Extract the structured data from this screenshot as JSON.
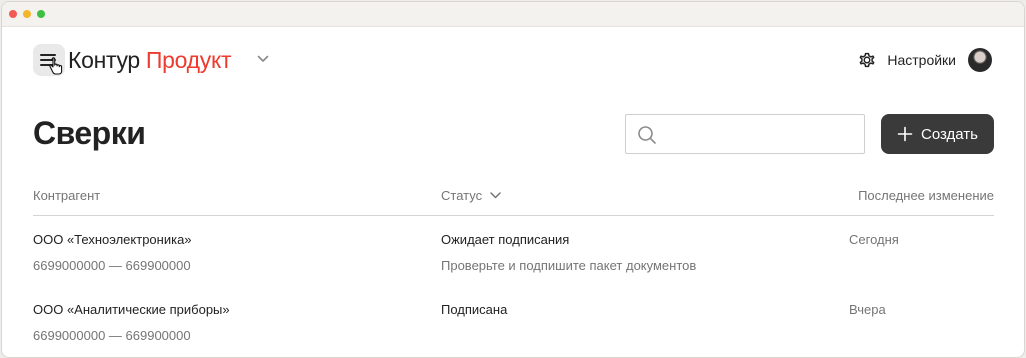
{
  "header": {
    "brand": "Контур",
    "product": "Продукт",
    "settings_label": "Настройки"
  },
  "page": {
    "title": "Сверки"
  },
  "toolbar": {
    "search_placeholder": "",
    "create_label": "Создать"
  },
  "table": {
    "columns": [
      "Контрагент",
      "Статус",
      "Последнее изменение"
    ],
    "rows": [
      {
        "name": "ООО «Техноэлектроника»",
        "inn": "6699000000 — 669900000",
        "status": "Ожидает подписания",
        "hint": "Проверьте и подпишите пакет документов",
        "date": "Сегодня"
      },
      {
        "name": "ООО «Аналитические приборы»",
        "inn": "6699000000 — 669900000",
        "status": "Подписана",
        "hint": "",
        "date": "Вчера"
      }
    ]
  },
  "icons": {
    "menu": "hamburger-menu-icon",
    "cursor": "hand-pointer-icon",
    "dropdown": "chevron-down-icon",
    "settings": "gear-icon",
    "search": "search-icon",
    "create": "plus-icon",
    "sort": "chevron-down-icon"
  },
  "colors": {
    "brand_accent": "#ee3b30",
    "primary_button": "#3a3a3a"
  }
}
